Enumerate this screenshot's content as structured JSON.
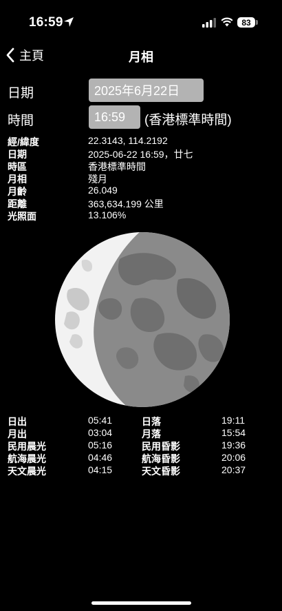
{
  "status": {
    "time": "16:59",
    "battery": "83",
    "icons": [
      "location-arrow-icon",
      "signal-icon",
      "wifi-icon",
      "battery-icon"
    ]
  },
  "nav": {
    "back_label": "主頁",
    "title": "月相"
  },
  "form": {
    "date_label": "日期",
    "date_value": "2025年6月22日",
    "time_label": "時間",
    "time_value": "16:59",
    "timezone_note": "(香港標準時間)"
  },
  "info": [
    {
      "label": "經/緯度",
      "value": "22.3143, 114.2192"
    },
    {
      "label": "日期",
      "value": "2025-06-22 16:59，廿七"
    },
    {
      "label": "時區",
      "value": "香港標準時間"
    },
    {
      "label": "月相",
      "value": "殘月"
    },
    {
      "label": "月齡",
      "value": "26.049"
    },
    {
      "label": "距離",
      "value": "363,634.199 公里"
    },
    {
      "label": "光照面",
      "value": "13.106%"
    }
  ],
  "times": [
    {
      "left_label": "日出",
      "left_value": "05:41",
      "right_label": "日落",
      "right_value": "19:11"
    },
    {
      "left_label": "月出",
      "left_value": "03:04",
      "right_label": "月落",
      "right_value": "15:54"
    },
    {
      "left_label": "民用晨光",
      "left_value": "05:16",
      "right_label": "民用昏影",
      "right_value": "19:36"
    },
    {
      "left_label": "航海晨光",
      "left_value": "04:46",
      "right_label": "航海昏影",
      "right_value": "20:06"
    },
    {
      "left_label": "天文晨光",
      "left_value": "04:15",
      "right_label": "天文昏影",
      "right_value": "20:37"
    }
  ],
  "colors": {
    "background": "#000000",
    "field": "#b3b3b3",
    "moon_lit": "#f2f2f2",
    "moon_shadow": "#8a8a8a"
  }
}
